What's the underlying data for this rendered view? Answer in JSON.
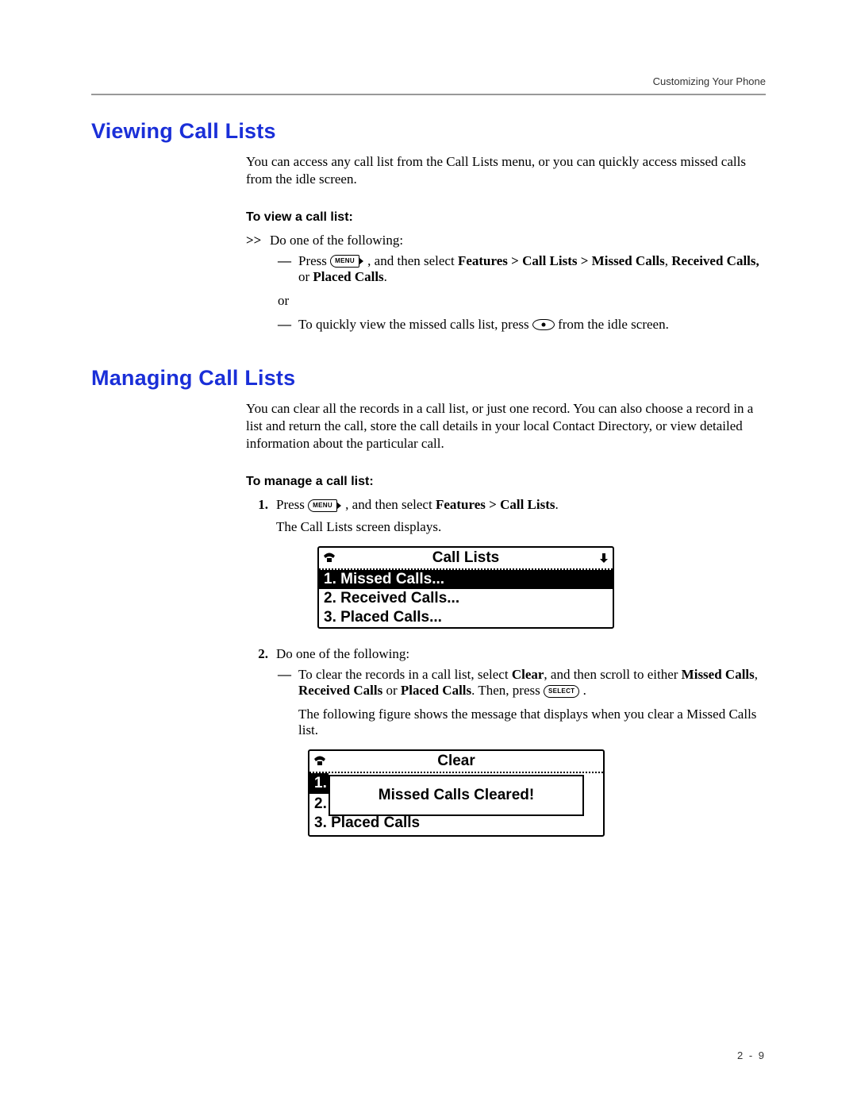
{
  "header": {
    "right": "Customizing Your Phone"
  },
  "footer": {
    "pagenum": "2 - 9"
  },
  "sections": {
    "viewing": {
      "title": "Viewing Call Lists",
      "intro": "You can access any call list from the Call Lists menu, or you can quickly access missed calls from the idle screen.",
      "subhead": "To view a call list:",
      "step_marker": ">>",
      "step_text": "Do one of the following:",
      "item1_pre": "Press ",
      "item1_mid": " , and then select ",
      "item1_nav": "Features > Call Lists > Missed Calls",
      "item1_tail1": ", ",
      "item1_tail2": "Received Calls,",
      "item1_tail3": " or ",
      "item1_tail4": "Placed Calls",
      "item1_tail5": ".",
      "or": "or",
      "item2_pre": "To quickly view the missed calls list, press ",
      "item2_post": " from the idle screen."
    },
    "managing": {
      "title": "Managing Call Lists",
      "intro": "You can clear all the records in a call list, or just one record. You can also choose a record in a list and return the call, store the call details in your local Contact Directory, or view detailed information about the particular call.",
      "subhead": "To manage a call list:",
      "step1_num": "1.",
      "step1_pre": "Press ",
      "step1_mid": ", and then select ",
      "step1_nav": "Features > Call Lists",
      "step1_end": ".",
      "step1_line2": "The Call Lists screen displays.",
      "step2_num": "2.",
      "step2_text": "Do one of the following:",
      "step2_item_pre": "To clear the records in a call list, select ",
      "step2_item_clear": "Clear",
      "step2_item_mid": ", and then scroll to either ",
      "step2_item_m": "Missed Calls",
      "step2_item_c1": ", ",
      "step2_item_r": "Received Calls",
      "step2_item_c2": " or ",
      "step2_item_p": "Placed Calls",
      "step2_item_then": ". Then, press ",
      "step2_item_end": " .",
      "step2_line2": "The following figure shows the message that displays when you clear a Missed Calls list."
    }
  },
  "keys": {
    "menu": "MENU",
    "select": "SELECT"
  },
  "lcd1": {
    "title": "Call Lists",
    "rows": [
      "1. Missed Calls...",
      "2. Received Calls...",
      "3. Placed Calls..."
    ],
    "selected": 0
  },
  "lcd2": {
    "title": "Clear",
    "left_nums": [
      "1.",
      "2."
    ],
    "left_selected": 0,
    "message": "Missed Calls Cleared!",
    "row3": "3. Placed Calls"
  }
}
